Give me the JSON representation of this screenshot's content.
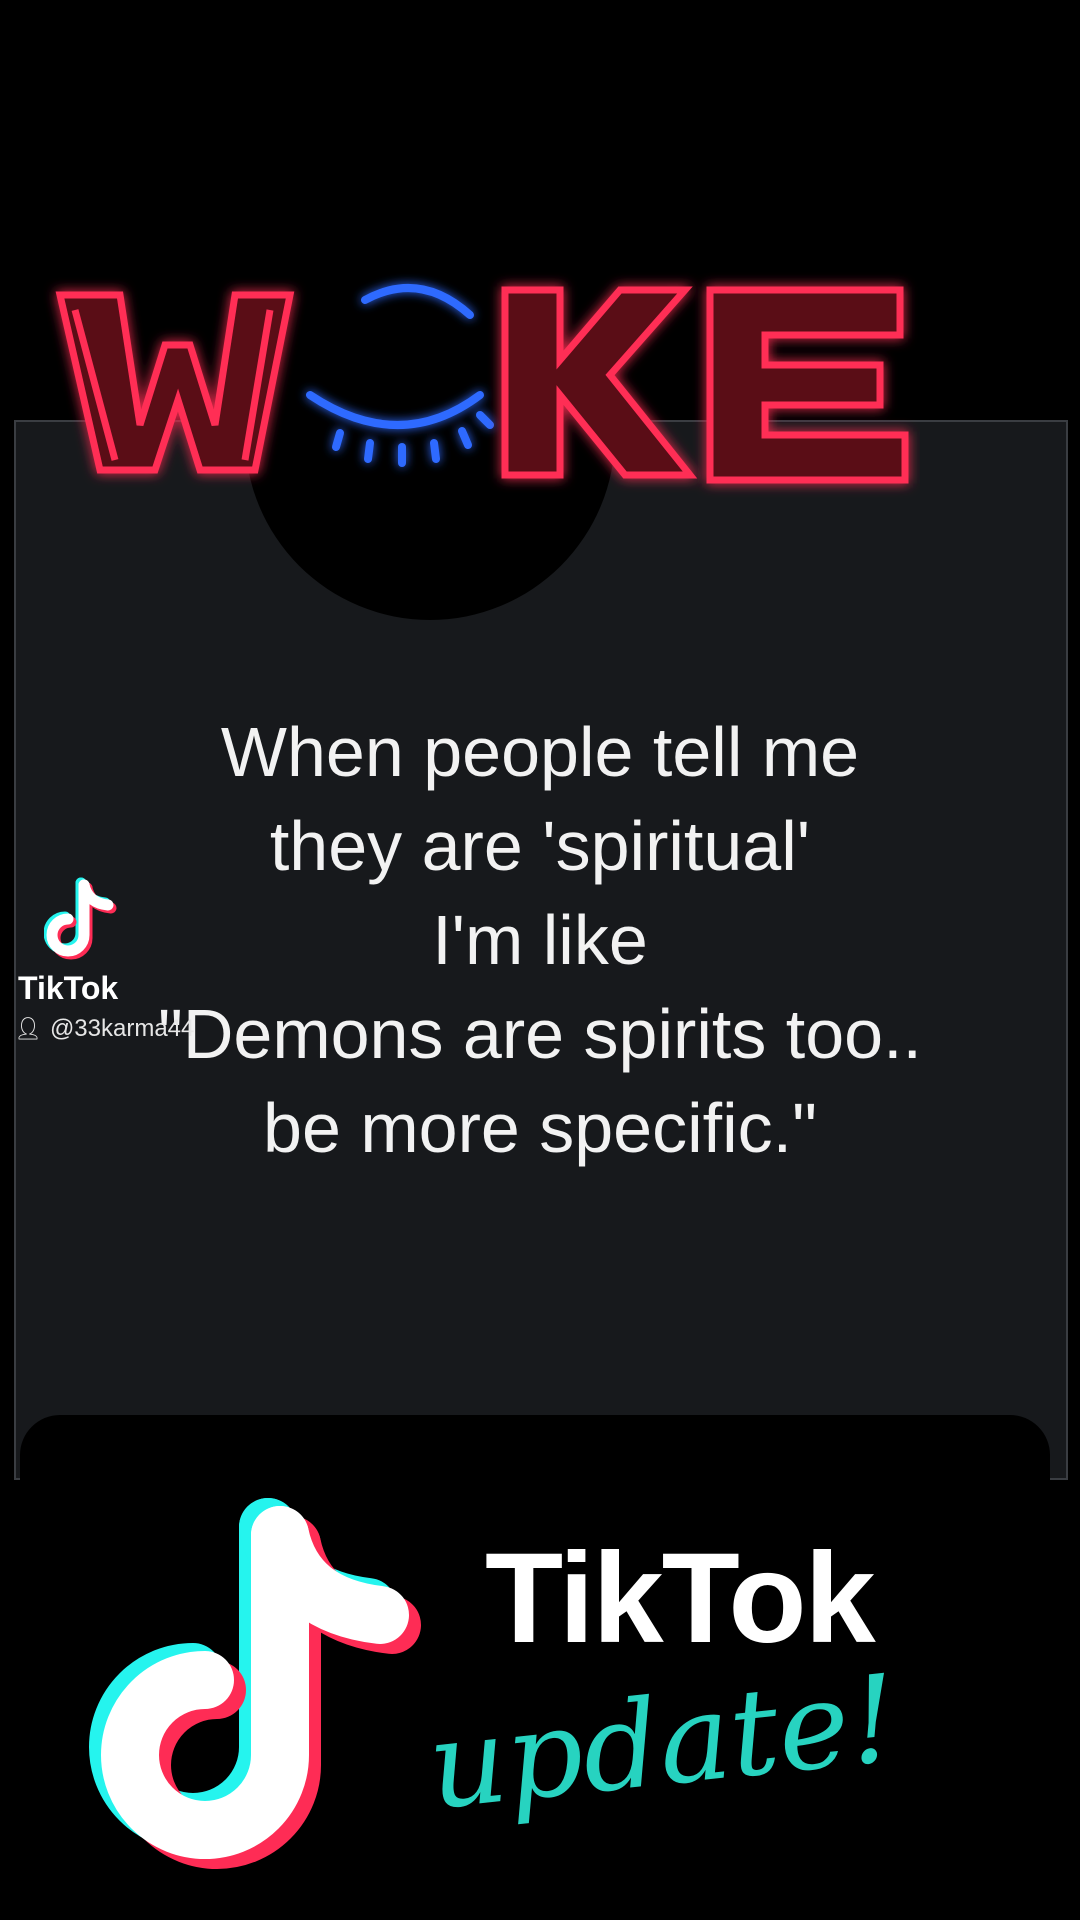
{
  "logo": {
    "text": "WOKE"
  },
  "quote": {
    "lines": [
      "When people tell me",
      "they are 'spiritual'",
      "I'm like",
      "\"Demons are spirits too..",
      "be more specific.\""
    ]
  },
  "watermark": {
    "brand": "TikTok",
    "username": "@33karma44"
  },
  "banner": {
    "brand": "TikTok",
    "tagline": "update!"
  },
  "colors": {
    "neon_red": "#ff2d55",
    "neon_blue": "#2f6bff",
    "tiktok_cyan": "#25f4ee",
    "tiktok_pink": "#fe2c55",
    "update_teal": "#27d3c0"
  },
  "icons": [
    "tiktok-note-icon",
    "person-icon",
    "eye-icon"
  ]
}
